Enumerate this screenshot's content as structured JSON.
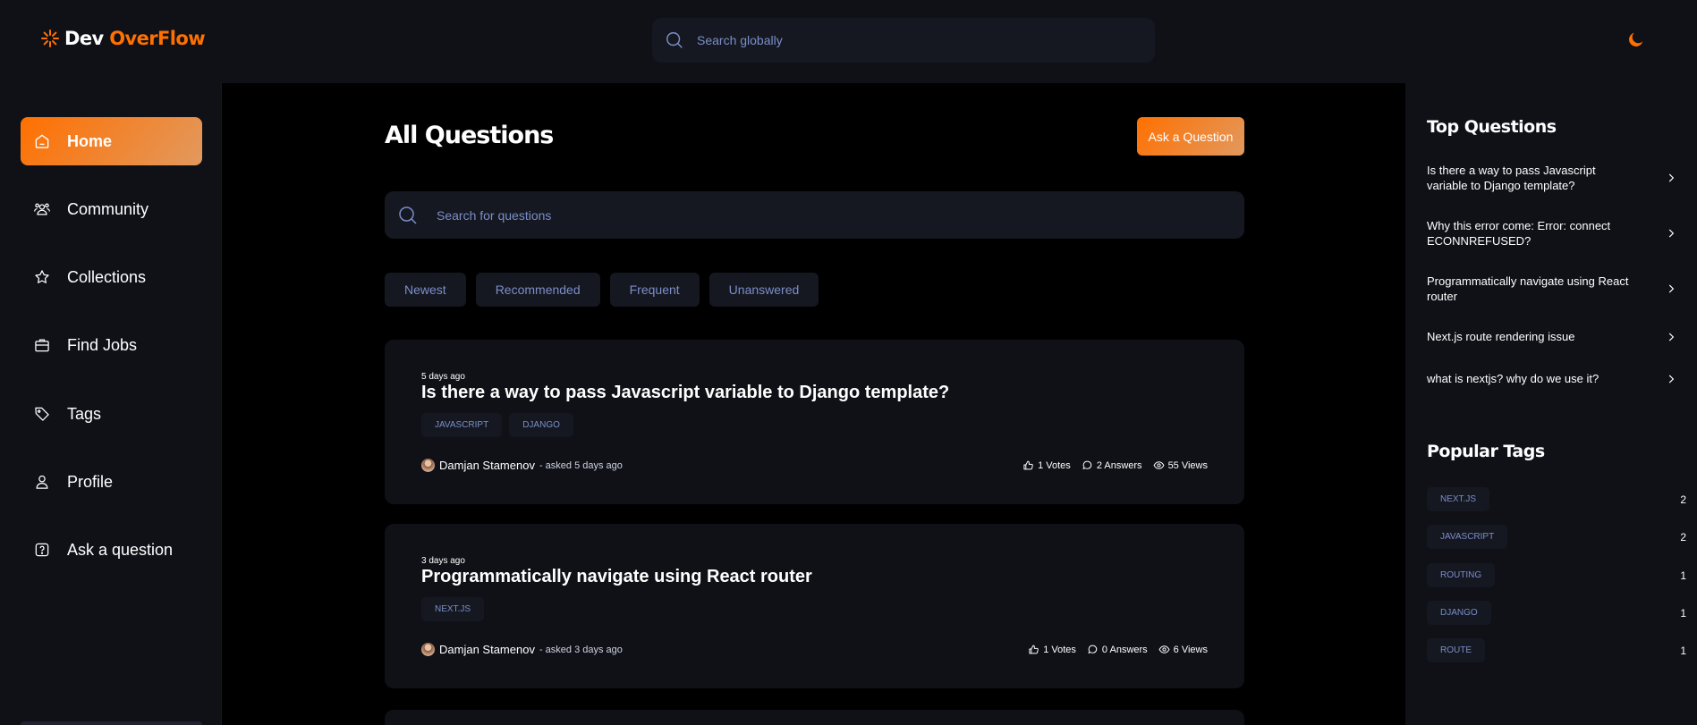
{
  "brand": {
    "name_part1": "Dev",
    "name_part2": "OverFlow",
    "accent": "#ff7000"
  },
  "header": {
    "search_placeholder": "Search globally",
    "theme_icon": "moon-icon"
  },
  "sidebar": {
    "items": [
      {
        "label": "Home",
        "icon": "home-icon",
        "active": true
      },
      {
        "label": "Community",
        "icon": "users-icon"
      },
      {
        "label": "Collections",
        "icon": "star-icon"
      },
      {
        "label": "Find Jobs",
        "icon": "suitcase-icon"
      },
      {
        "label": "Tags",
        "icon": "tag-icon"
      },
      {
        "label": "Profile",
        "icon": "user-icon"
      },
      {
        "label": "Ask a question",
        "icon": "question-icon"
      }
    ]
  },
  "main": {
    "title": "All Questions",
    "ask_button": "Ask a Question",
    "search_placeholder": "Search for questions",
    "filters": [
      "Newest",
      "Recommended",
      "Frequent",
      "Unanswered"
    ],
    "questions": [
      {
        "timestamp": "5 days ago",
        "title": "Is there a way to pass Javascript variable to Django template?",
        "tags": [
          "JAVASCRIPT",
          "DJANGO"
        ],
        "author": "Damjan Stamenov",
        "asked": " - asked 5 days ago",
        "votes": "1 Votes",
        "answers": "2 Answers",
        "views": "55 Views"
      },
      {
        "timestamp": "3 days ago",
        "title": "Programmatically navigate using React router",
        "tags": [
          "NEXT.JS"
        ],
        "author": "Damjan Stamenov",
        "asked": " - asked 3 days ago",
        "votes": "1 Votes",
        "answers": "0 Answers",
        "views": "6 Views"
      }
    ]
  },
  "right_sidebar": {
    "top_title": "Top Questions",
    "top_questions": [
      "Is there a way to pass Javascript variable to Django template?",
      "Why this error come: Error: connect ECONNREFUSED?",
      "Programmatically navigate using React router",
      "Next.js route rendering issue",
      "what is nextjs? why do we use it?"
    ],
    "tags_title": "Popular Tags",
    "popular_tags": [
      {
        "name": "NEXT.JS",
        "count": "2"
      },
      {
        "name": "JAVASCRIPT",
        "count": "2"
      },
      {
        "name": "ROUTING",
        "count": "1"
      },
      {
        "name": "DJANGO",
        "count": "1"
      },
      {
        "name": "ROUTE",
        "count": "1"
      }
    ]
  }
}
